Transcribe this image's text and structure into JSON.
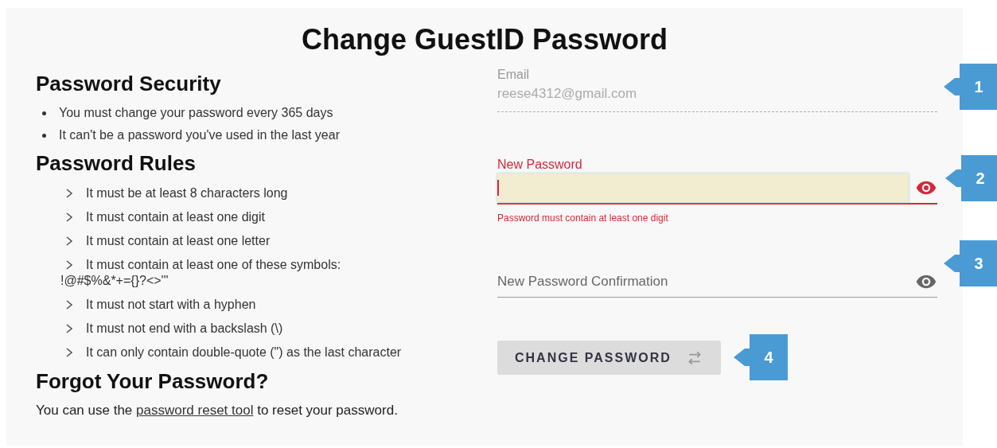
{
  "title": "Change GuestID Password",
  "security": {
    "heading": "Password Security",
    "items": [
      "You must change your password every 365 days",
      "It can't be a password you've used in the last year"
    ]
  },
  "rules": {
    "heading": "Password Rules",
    "items": [
      {
        "text": "It must be at least 8 characters long"
      },
      {
        "text": "It must contain at least one digit"
      },
      {
        "text": "It must contain at least one letter"
      },
      {
        "text": "It must contain at least one of these symbols:",
        "continuation": "!@#$%&*+={}?<>'\""
      },
      {
        "text": "It must not start with a hyphen"
      },
      {
        "text": "It must not end with a backslash (\\)"
      },
      {
        "text": "It can only contain double-quote (\") as the last character"
      }
    ]
  },
  "forgot": {
    "heading": "Forgot Your Password?",
    "before": "You can use the ",
    "link": "password reset tool",
    "after": " to reset your password."
  },
  "email": {
    "label": "Email",
    "value": "reese4312@gmail.com"
  },
  "new_password": {
    "label": "New Password",
    "invalid": true,
    "error": "Password must contain at least one digit"
  },
  "confirmation": {
    "placeholder": "New Password Confirmation",
    "invalid": false
  },
  "button": {
    "label": "CHANGE PASSWORD"
  },
  "callouts": [
    "1",
    "2",
    "3",
    "4"
  ]
}
